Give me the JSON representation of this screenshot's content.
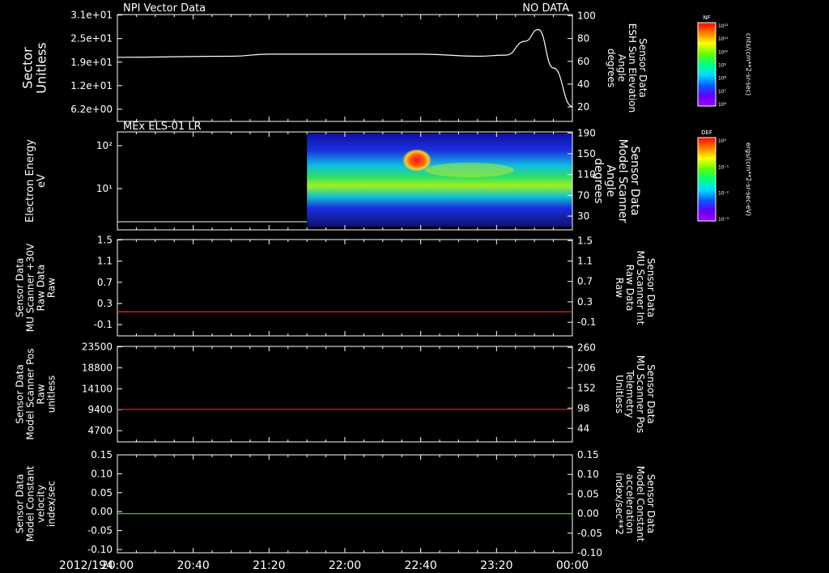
{
  "title_left": "NPI Vector Data",
  "title_right": "NO DATA",
  "panel2_title": "MEx ELS-01 LR",
  "colorbars": [
    {
      "tag": "NF",
      "unit": "cnts/(cm**2-sr-sec)",
      "ticks": [
        "10¹²",
        "10¹¹",
        "10¹⁰",
        "10⁹",
        "10⁸",
        "10⁷",
        "10⁶"
      ]
    },
    {
      "tag": "DEF",
      "unit": "ergs/(cm**2-sr-sec-eV)",
      "ticks": [
        "10⁰",
        "10⁻¹",
        "10⁻²",
        "10⁻³"
      ]
    }
  ],
  "chart_data": {
    "type": "line",
    "x_date": "2012/194",
    "x_ticks": [
      "20:00",
      "20:40",
      "21:20",
      "22:00",
      "22:40",
      "23:20",
      "00:00"
    ],
    "panels": [
      {
        "id": "sector",
        "left_label": [
          "Sector",
          "Unitless"
        ],
        "left_ticks": [
          "3.1e+01",
          "2.5e+01",
          "1.9e+01",
          "1.2e+01",
          "6.2e+00"
        ],
        "right_label": [
          "Sensor Data",
          "ESH Sun Elevation",
          "Angle",
          "degrees"
        ],
        "right_ticks": [
          "100",
          "80",
          "60",
          "40",
          "20"
        ],
        "ylim": [
          0,
          100
        ],
        "series": [
          {
            "color": "#ffffff",
            "x": [
              "20:00",
              "21:00",
              "21:20",
              "22:40",
              "23:10",
              "23:25",
              "23:35",
              "23:42",
              "23:50",
              "24:00"
            ],
            "y": [
              60,
              61,
              63,
              63,
              61,
              62,
              75,
              86,
              50,
              14
            ]
          }
        ]
      },
      {
        "id": "els",
        "left_label": [
          "Electron Energy",
          "eV"
        ],
        "left_ticks": [
          "10²",
          "10¹"
        ],
        "right_label": [
          "Sensor Data",
          "Model Scanner",
          "Angle",
          "degrees"
        ],
        "right_ticks": [
          "190",
          "150",
          "110",
          "70",
          "30"
        ],
        "spectrogram_start": "21:40"
      },
      {
        "id": "mu_plus30",
        "left_label": [
          "Sensor Data",
          "MU Scanner +30V",
          "Raw Data",
          "Raw"
        ],
        "left_ticks": [
          "1.5",
          "1.1",
          "0.7",
          "0.3",
          "-0.1"
        ],
        "right_label": [
          "Sensor Data",
          "MU Scanner Int",
          "Raw Data",
          "Raw"
        ],
        "right_ticks": [
          "1.5",
          "1.1",
          "0.7",
          "0.3",
          "-0.1"
        ],
        "ylim": [
          -0.5,
          1.5
        ],
        "series": [
          {
            "color": "#ff2020",
            "x": [
              "20:00",
              "24:00"
            ],
            "y": [
              0,
              0
            ]
          }
        ]
      },
      {
        "id": "scanner_pos",
        "left_label": [
          "Sensor Data",
          "Model Scanner Pos",
          "Raw",
          "unitless"
        ],
        "left_ticks": [
          "23500",
          "18800",
          "14100",
          "9400",
          "4700"
        ],
        "right_label": [
          "Sensor Data",
          "MU Scanner Pos",
          "Telemetry",
          "Unitless"
        ],
        "right_ticks": [
          "260",
          "206",
          "152",
          "98",
          "44"
        ],
        "ylim": [
          0,
          23500
        ],
        "series": [
          {
            "color": "#ff2020",
            "x": [
              "20:00",
              "24:00"
            ],
            "y": [
              8000,
              8000
            ]
          }
        ]
      },
      {
        "id": "velocity",
        "left_label": [
          "Sensor Data",
          "Model Constant",
          "velocity",
          "index/sec"
        ],
        "left_ticks": [
          "0.15",
          "0.10",
          "0.05",
          "0.00",
          "-0.05",
          "-0.10"
        ],
        "right_label": [
          "Sensor Data",
          "Model Constant",
          "acceleration",
          "index/sec**2"
        ],
        "right_ticks": [
          "0.15",
          "0.10",
          "0.05",
          "0.00",
          "-0.05",
          "-0.10"
        ],
        "ylim": [
          -0.1,
          0.15
        ],
        "series": [
          {
            "color": "#10e010",
            "x": [
              "20:00",
              "24:00"
            ],
            "y": [
              0,
              0
            ]
          }
        ]
      }
    ]
  }
}
